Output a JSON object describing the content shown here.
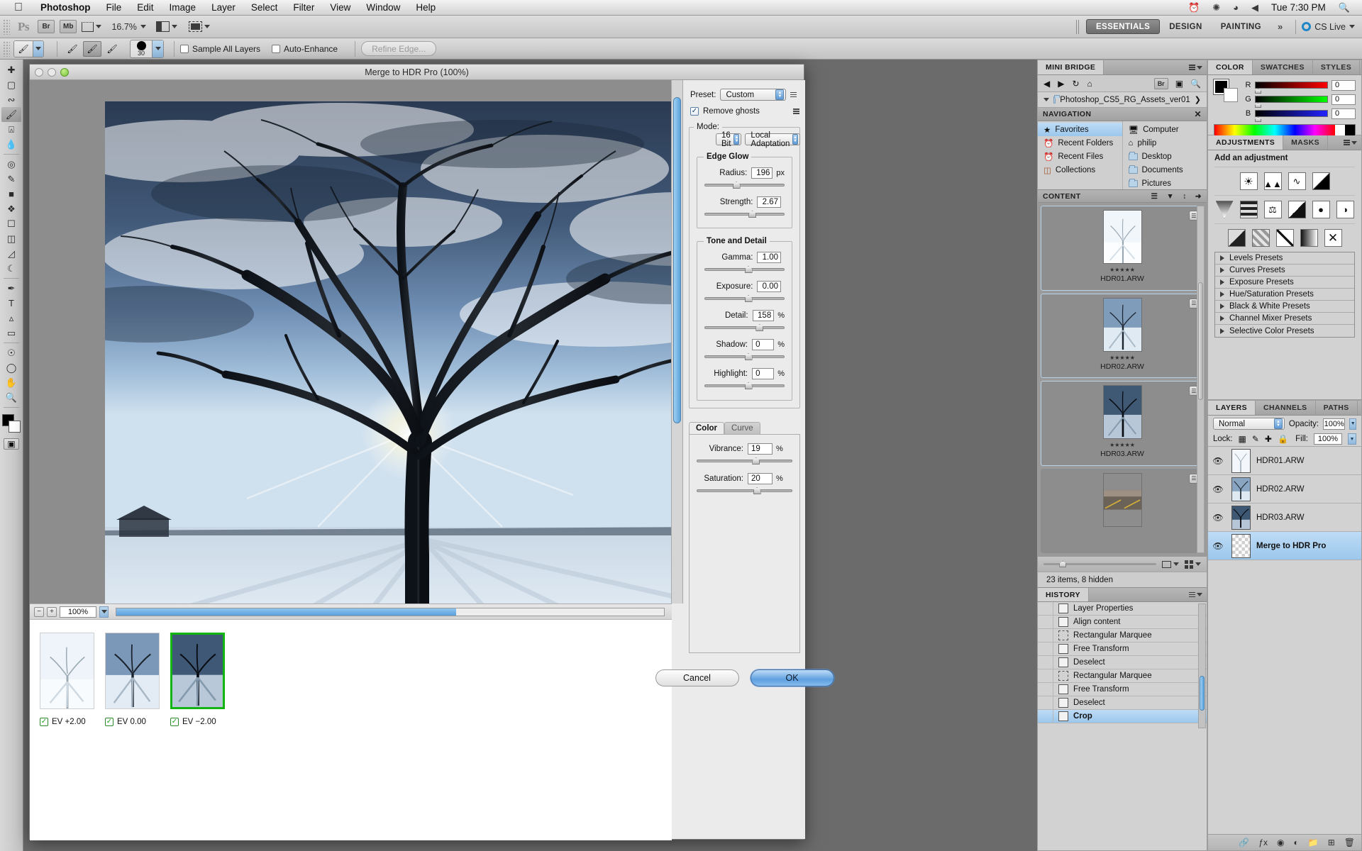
{
  "macbar": {
    "apple": "apple-logo",
    "menus": [
      "Photoshop",
      "File",
      "Edit",
      "Image",
      "Layer",
      "Select",
      "Filter",
      "View",
      "Window",
      "Help"
    ],
    "right_icons": [
      "time-machine-icon",
      "bluetooth-icon",
      "wifi-icon",
      "volume-icon"
    ],
    "time": "Tue 7:30 PM",
    "spotlight": "search-icon"
  },
  "appbar": {
    "logo": "Ps",
    "bridge_label": "Br",
    "minibridge_label": "Mb",
    "zoom": "16.7%",
    "workspaces": [
      "ESSENTIALS",
      "DESIGN",
      "PAINTING"
    ],
    "more": "»",
    "cslive": "CS Live"
  },
  "options": {
    "sample_all_layers": "Sample All Layers",
    "auto_enhance": "Auto-Enhance",
    "refine_edge": "Refine Edge...",
    "brush_size": "30"
  },
  "dialog": {
    "title": "Merge to HDR Pro (100%)",
    "preset_label": "Preset:",
    "preset_value": "Custom",
    "remove_ghosts": "Remove ghosts",
    "mode_label": "Mode:",
    "mode_bits": "16 Bit",
    "mode_method": "Local Adaptation",
    "edge_glow": "Edge Glow",
    "tone_detail": "Tone and Detail",
    "sliders": [
      {
        "group": "edge",
        "label": "Radius:",
        "value": "196",
        "unit": "px",
        "pos": 35
      },
      {
        "group": "edge",
        "label": "Strength:",
        "value": "2.67",
        "unit": "",
        "pos": 55
      },
      {
        "group": "tone",
        "label": "Gamma:",
        "value": "1.00",
        "unit": "",
        "pos": 50
      },
      {
        "group": "tone",
        "label": "Exposure:",
        "value": "0.00",
        "unit": "",
        "pos": 50
      },
      {
        "group": "tone",
        "label": "Detail:",
        "value": "158",
        "unit": "%",
        "pos": 64
      },
      {
        "group": "tone",
        "label": "Shadow:",
        "value": "0",
        "unit": "%",
        "pos": 50
      },
      {
        "group": "tone",
        "label": "Highlight:",
        "value": "0",
        "unit": "%",
        "pos": 50
      }
    ],
    "tabs": [
      "Color",
      "Curve"
    ],
    "active_tab": "Color",
    "color_sliders": [
      {
        "label": "Vibrance:",
        "value": "19",
        "unit": "%",
        "pos": 58
      },
      {
        "label": "Saturation:",
        "value": "20",
        "unit": "%",
        "pos": 59
      }
    ],
    "zoom_level": "100%",
    "exposures": [
      {
        "label": "EV +2.00",
        "checked": true,
        "selected": false
      },
      {
        "label": "EV 0.00",
        "checked": true,
        "selected": false
      },
      {
        "label": "EV −2.00",
        "checked": true,
        "selected": true
      }
    ],
    "cancel": "Cancel",
    "ok": "OK"
  },
  "minibridge": {
    "tab": "MINI BRIDGE",
    "nav_icons": [
      "back-arrow-icon",
      "forward-arrow-icon",
      "refresh-icon",
      "home-icon",
      "bridge-icon",
      "panel-view-icon",
      "search-icon"
    ],
    "path": "Photoshop_CS5_RG_Assets_ver01",
    "navigation_header": "NAVIGATION",
    "nav_left": [
      {
        "label": "Favorites",
        "icon": "star-icon",
        "selected": true
      },
      {
        "label": "Recent Folders",
        "icon": "clock-icon",
        "selected": false
      },
      {
        "label": "Recent Files",
        "icon": "clock-icon",
        "selected": false
      },
      {
        "label": "Collections",
        "icon": "collection-icon",
        "selected": false
      }
    ],
    "nav_right": [
      {
        "label": "Computer",
        "icon": "computer-icon"
      },
      {
        "label": "philip",
        "icon": "home-icon"
      },
      {
        "label": "Desktop",
        "icon": "folder-icon"
      },
      {
        "label": "Documents",
        "icon": "folder-icon"
      },
      {
        "label": "Pictures",
        "icon": "folder-icon"
      }
    ],
    "content_header": "CONTENT",
    "content_icons": [
      "list-view-icon",
      "filter-icon",
      "sort-icon",
      "export-icon"
    ],
    "items": [
      {
        "name": "HDR01.ARW",
        "stars": 5
      },
      {
        "name": "HDR02.ARW",
        "stars": 5
      },
      {
        "name": "HDR03.ARW",
        "stars": 5
      },
      {
        "name": "",
        "stars": 0
      }
    ],
    "status": "23 items, 8 hidden"
  },
  "colorpanel": {
    "tabs": [
      "COLOR",
      "SWATCHES",
      "STYLES"
    ],
    "active_tab": "COLOR",
    "channels": [
      {
        "label": "R",
        "value": "0"
      },
      {
        "label": "G",
        "value": "0"
      },
      {
        "label": "B",
        "value": "0"
      }
    ]
  },
  "adjustments": {
    "tabs": [
      "ADJUSTMENTS",
      "MASKS"
    ],
    "active_tab": "ADJUSTMENTS",
    "heading": "Add an adjustment",
    "icons_row1": [
      "brightness-contrast-icon",
      "levels-icon",
      "curves-icon",
      "exposure-icon"
    ],
    "icons_row2": [
      "vibrance-icon",
      "hue-saturation-icon",
      "color-balance-icon",
      "black-white-icon",
      "photo-filter-icon",
      "channel-mixer-icon"
    ],
    "icons_row3": [
      "invert-icon",
      "posterize-icon",
      "threshold-icon",
      "gradient-map-icon",
      "selective-color-icon"
    ],
    "presets": [
      "Levels Presets",
      "Curves Presets",
      "Exposure Presets",
      "Hue/Saturation Presets",
      "Black & White Presets",
      "Channel Mixer Presets",
      "Selective Color Presets"
    ]
  },
  "layers": {
    "tabs": [
      "LAYERS",
      "CHANNELS",
      "PATHS"
    ],
    "active_tab": "LAYERS",
    "blend_mode": "Normal",
    "opacity_label": "Opacity:",
    "opacity_value": "100%",
    "lock_label": "Lock:",
    "lock_icons": [
      "lock-transparency-icon",
      "lock-image-icon",
      "lock-position-icon",
      "lock-all-icon"
    ],
    "fill_label": "Fill:",
    "fill_value": "100%",
    "rows": [
      {
        "name": "HDR01.ARW",
        "visible": true,
        "selected": false,
        "thumb": "image"
      },
      {
        "name": "HDR02.ARW",
        "visible": true,
        "selected": false,
        "thumb": "image"
      },
      {
        "name": "HDR03.ARW",
        "visible": true,
        "selected": false,
        "thumb": "image"
      },
      {
        "name": "Merge to HDR Pro",
        "visible": true,
        "selected": true,
        "thumb": "transparent"
      }
    ],
    "footer_icons": [
      "link-icon",
      "fx-icon",
      "mask-icon",
      "group-icon",
      "new-layer-icon",
      "adjustment-icon",
      "delete-icon"
    ]
  },
  "history": {
    "tab": "HISTORY",
    "rows": [
      {
        "label": "Layer Properties",
        "icon": "doc-icon",
        "selected": false
      },
      {
        "label": "Align content",
        "icon": "doc-icon",
        "selected": false
      },
      {
        "label": "Rectangular Marquee",
        "icon": "marquee-icon",
        "selected": false
      },
      {
        "label": "Free Transform",
        "icon": "doc-icon",
        "selected": false
      },
      {
        "label": "Deselect",
        "icon": "doc-icon",
        "selected": false
      },
      {
        "label": "Rectangular Marquee",
        "icon": "marquee-icon",
        "selected": false
      },
      {
        "label": "Free Transform",
        "icon": "doc-icon",
        "selected": false
      },
      {
        "label": "Deselect",
        "icon": "doc-icon",
        "selected": false
      },
      {
        "label": "Crop",
        "icon": "crop-icon",
        "selected": true
      }
    ]
  },
  "toolbox": {
    "tools": [
      "move-tool",
      "marquee-tool",
      "lasso-tool",
      "quick-selection-tool",
      "crop-tool",
      "eyedropper-tool",
      "spot-healing-tool",
      "brush-tool",
      "clone-stamp-tool",
      "history-brush-tool",
      "eraser-tool",
      "gradient-tool",
      "blur-tool",
      "dodge-tool",
      "pen-tool",
      "type-tool",
      "path-selection-tool",
      "shape-tool",
      "3d-rotate-tool",
      "3d-orbit-tool",
      "hand-tool",
      "zoom-tool"
    ]
  },
  "colors": {
    "accent_blue": "#5ba0e0",
    "selection_blue": "#9cc7ec",
    "selected_green": "#13b513",
    "panel_gray": "#d2d2d2"
  }
}
